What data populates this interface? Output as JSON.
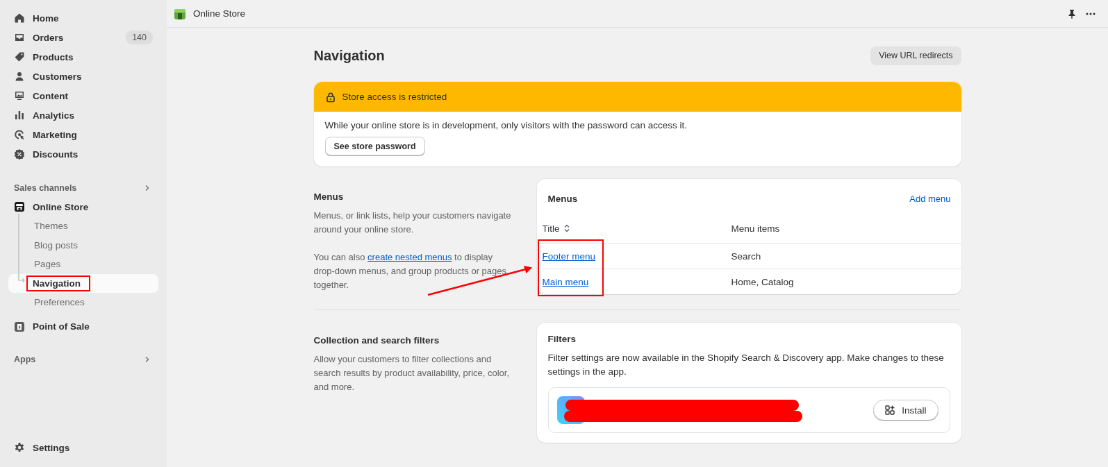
{
  "sidebar": {
    "primary": [
      {
        "label": "Home"
      },
      {
        "label": "Orders",
        "badge": "140"
      },
      {
        "label": "Products"
      },
      {
        "label": "Customers"
      },
      {
        "label": "Content"
      },
      {
        "label": "Analytics"
      },
      {
        "label": "Marketing"
      },
      {
        "label": "Discounts"
      }
    ],
    "sections": [
      {
        "title": "Sales channels",
        "items": [
          {
            "label": "Online Store",
            "children": [
              {
                "label": "Themes",
                "selected": false,
                "annotated": false
              },
              {
                "label": "Blog posts",
                "selected": false,
                "annotated": false
              },
              {
                "label": "Pages",
                "selected": false,
                "annotated": false
              },
              {
                "label": "Navigation",
                "selected": true,
                "annotated": true
              },
              {
                "label": "Preferences",
                "selected": false,
                "annotated": false
              }
            ]
          },
          {
            "label": "Point of Sale"
          }
        ]
      },
      {
        "title": "Apps"
      }
    ],
    "footer": [
      {
        "label": "Settings"
      }
    ]
  },
  "top_bar": {
    "title": "Online Store"
  },
  "page": {
    "title": "Navigation",
    "action": "View URL redirects"
  },
  "banner": {
    "kind": "warning",
    "title": "Store access is restricted",
    "text": "While your online store is in development, only visitors with the password can access it.",
    "button": "See store password"
  },
  "menus_section": {
    "title": "Menus",
    "description": "Menus, or link lists, help your customers navigate around your online store.",
    "note": {
      "before": "You can also ",
      "link": "create nested menus",
      "after": " to display drop-down menus, and group products or pages together."
    },
    "card": {
      "title": "Menus",
      "action": "Add menu",
      "columns": [
        {
          "label": "Title",
          "sortable": true
        },
        {
          "label": "Menu items",
          "sortable": false
        }
      ],
      "rows": [
        {
          "title": "Footer menu",
          "items": "Search"
        },
        {
          "title": "Main menu",
          "items": "Home, Catalog"
        }
      ],
      "titles_annotated": true,
      "arrow": true
    }
  },
  "filters_section": {
    "title": "Collection and search filters",
    "description": "Allow your customers to filter collections and search results by product availability, price, color, and more.",
    "card": {
      "title": "Filters",
      "text": "Filter settings are now available in the Shopify Search & Discovery app. Make changes to these settings in the app.",
      "app": {
        "redacted": true,
        "button": "Install"
      }
    }
  }
}
